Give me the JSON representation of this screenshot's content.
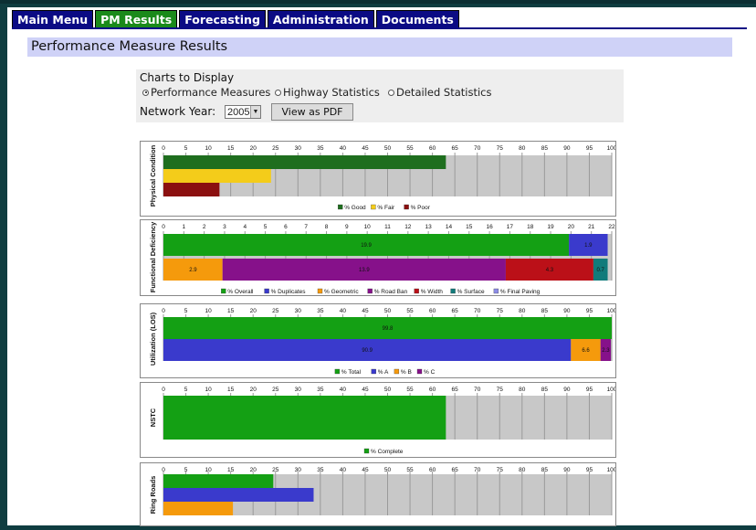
{
  "nav": {
    "tabs": [
      {
        "label": "Main Menu",
        "active": false
      },
      {
        "label": "PM Results",
        "active": true
      },
      {
        "label": "Forecasting",
        "active": false
      },
      {
        "label": "Administration",
        "active": false
      },
      {
        "label": "Documents",
        "active": false
      }
    ]
  },
  "page": {
    "title": "Performance Measure Results"
  },
  "controls": {
    "charts_label": "Charts to Display",
    "options": [
      {
        "label": "Performance Measures",
        "selected": true
      },
      {
        "label": "Highway Statistics",
        "selected": false
      },
      {
        "label": "Detailed Statistics",
        "selected": false
      }
    ],
    "year_label": "Network Year:",
    "year_value": "2005",
    "pdf_button": "View as PDF"
  },
  "chart_data": [
    {
      "type": "bar",
      "ylabel": "Physical Condition",
      "xlim": [
        0,
        100
      ],
      "ticks": [
        "0",
        "5",
        "10",
        "15",
        "20",
        "25",
        "30",
        "35",
        "40",
        "45",
        "50",
        "55",
        "60",
        "65",
        "70",
        "75",
        "80",
        "85",
        "90",
        "95",
        "100"
      ],
      "bars": [
        {
          "segments": [
            {
              "series": "% Good",
              "value": 63,
              "color": "#1e6e1e",
              "label": ""
            }
          ]
        },
        {
          "segments": [
            {
              "series": "% Fair",
              "value": 24,
              "color": "#f4cc1a",
              "label": ""
            }
          ]
        },
        {
          "segments": [
            {
              "series": "% Poor",
              "value": 12.5,
              "color": "#8b1010",
              "label": ""
            }
          ]
        }
      ],
      "legend": [
        {
          "name": "% Good",
          "color": "#1e6e1e"
        },
        {
          "name": "% Fair",
          "color": "#f4cc1a"
        },
        {
          "name": "% Poor",
          "color": "#8b1010"
        }
      ]
    },
    {
      "type": "bar",
      "ylabel": "Functional Deficiency",
      "xlim": [
        0,
        22
      ],
      "ticks": [
        "0",
        "1",
        "2",
        "3",
        "4",
        "5",
        "6",
        "7",
        "8",
        "9",
        "10",
        "11",
        "12",
        "13",
        "14",
        "15",
        "16",
        "17",
        "18",
        "19",
        "20",
        "21",
        "22"
      ],
      "bars": [
        {
          "segments": [
            {
              "series": "% Overall",
              "value": 19.9,
              "color": "#14a014",
              "label": "19.9"
            },
            {
              "series": "% Duplicates",
              "value": 1.9,
              "color": "#3a3acc",
              "label": "1.9"
            }
          ]
        },
        {
          "segments": [
            {
              "series": "% Geometric",
              "value": 2.9,
              "color": "#f59a0c",
              "label": "2.9"
            },
            {
              "series": "% Road Ban",
              "value": 13.9,
              "color": "#86118a",
              "label": "13.9"
            },
            {
              "series": "% Width",
              "value": 4.3,
              "color": "#bb1018",
              "label": "4.3"
            },
            {
              "series": "% Surface",
              "value": 0.7,
              "color": "#127b7b",
              "label": "0.7"
            }
          ]
        }
      ],
      "legend": [
        {
          "name": "% Overall",
          "color": "#14a014"
        },
        {
          "name": "% Duplicates",
          "color": "#3a3acc"
        },
        {
          "name": "% Geometric",
          "color": "#f59a0c"
        },
        {
          "name": "% Road Ban",
          "color": "#86118a"
        },
        {
          "name": "% Width",
          "color": "#bb1018"
        },
        {
          "name": "% Surface",
          "color": "#127b7b"
        },
        {
          "name": "% Final Paving",
          "color": "#8c8ce6"
        }
      ]
    },
    {
      "type": "bar",
      "ylabel": "Utilization (LOS)",
      "xlim": [
        0,
        100
      ],
      "ticks": [
        "0",
        "5",
        "10",
        "15",
        "20",
        "25",
        "30",
        "35",
        "40",
        "45",
        "50",
        "55",
        "60",
        "65",
        "70",
        "75",
        "80",
        "85",
        "90",
        "95",
        "100"
      ],
      "bars": [
        {
          "segments": [
            {
              "series": "% Total",
              "value": 100,
              "color": "#14a014",
              "label": "99.8"
            }
          ]
        },
        {
          "segments": [
            {
              "series": "% A",
              "value": 90.9,
              "color": "#3a3acc",
              "label": "90.9"
            },
            {
              "series": "% B",
              "value": 6.6,
              "color": "#f59a0c",
              "label": "6.6"
            },
            {
              "series": "% C",
              "value": 2.3,
              "color": "#86118a",
              "label": "2.3"
            }
          ]
        }
      ],
      "legend": [
        {
          "name": "% Total",
          "color": "#14a014"
        },
        {
          "name": "% A",
          "color": "#3a3acc"
        },
        {
          "name": "% B",
          "color": "#f59a0c"
        },
        {
          "name": "% C",
          "color": "#86118a"
        }
      ]
    },
    {
      "type": "bar",
      "ylabel": "NSTC",
      "xlim": [
        0,
        100
      ],
      "ticks": [
        "0",
        "5",
        "10",
        "15",
        "20",
        "25",
        "30",
        "35",
        "40",
        "45",
        "50",
        "55",
        "60",
        "65",
        "70",
        "75",
        "80",
        "85",
        "90",
        "95",
        "100"
      ],
      "bars": [
        {
          "segments": [
            {
              "series": "% Complete",
              "value": 63,
              "color": "#14a014",
              "label": ""
            }
          ]
        }
      ],
      "legend": [
        {
          "name": "% Complete",
          "color": "#14a014"
        }
      ]
    },
    {
      "type": "bar",
      "ylabel": "Ring Roads",
      "xlim": [
        0,
        100
      ],
      "ticks": [
        "0",
        "5",
        "10",
        "15",
        "20",
        "25",
        "30",
        "35",
        "40",
        "45",
        "50",
        "55",
        "60",
        "65",
        "70",
        "75",
        "80",
        "85",
        "90",
        "95",
        "100"
      ],
      "bars": [
        {
          "segments": [
            {
              "series": "",
              "value": 24.5,
              "color": "#14a014",
              "label": ""
            }
          ]
        },
        {
          "segments": [
            {
              "series": "",
              "value": 33.5,
              "color": "#3a3acc",
              "label": ""
            }
          ]
        },
        {
          "segments": [
            {
              "series": "",
              "value": 15.5,
              "color": "#f59a0c",
              "label": ""
            }
          ]
        }
      ],
      "legend": []
    }
  ]
}
